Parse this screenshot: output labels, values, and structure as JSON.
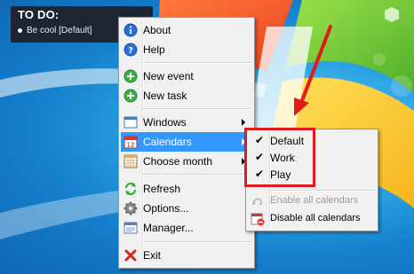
{
  "todo": {
    "title": "TO DO:",
    "items": [
      "Be cool [Default]"
    ]
  },
  "menu": {
    "items": [
      {
        "label": "About",
        "icon": "info-icon"
      },
      {
        "label": "Help",
        "icon": "help-icon"
      },
      {
        "label": "New event",
        "icon": "add-event-icon"
      },
      {
        "label": "New task",
        "icon": "add-task-icon"
      },
      {
        "label": "Windows",
        "icon": "windows-icon"
      },
      {
        "label": "Calendars",
        "icon": "calendar-icon",
        "highlighted": true
      },
      {
        "label": "Choose month",
        "icon": "month-grid-icon"
      },
      {
        "label": "Refresh",
        "icon": "refresh-icon"
      },
      {
        "label": "Options...",
        "icon": "gear-icon"
      },
      {
        "label": "Manager...",
        "icon": "manager-icon"
      },
      {
        "label": "Exit",
        "icon": "close-icon"
      }
    ]
  },
  "submenu": {
    "calendars": [
      {
        "label": "Default",
        "checked": true
      },
      {
        "label": "Work",
        "checked": true
      },
      {
        "label": "Play",
        "checked": true
      }
    ],
    "enable_all": "Enable all calendars",
    "disable_all": "Disable all calendars",
    "checkmark": "✔"
  },
  "colors": {
    "highlight": "#3399ff",
    "annotation": "#e01b1b",
    "desktop": "#1580cc"
  }
}
